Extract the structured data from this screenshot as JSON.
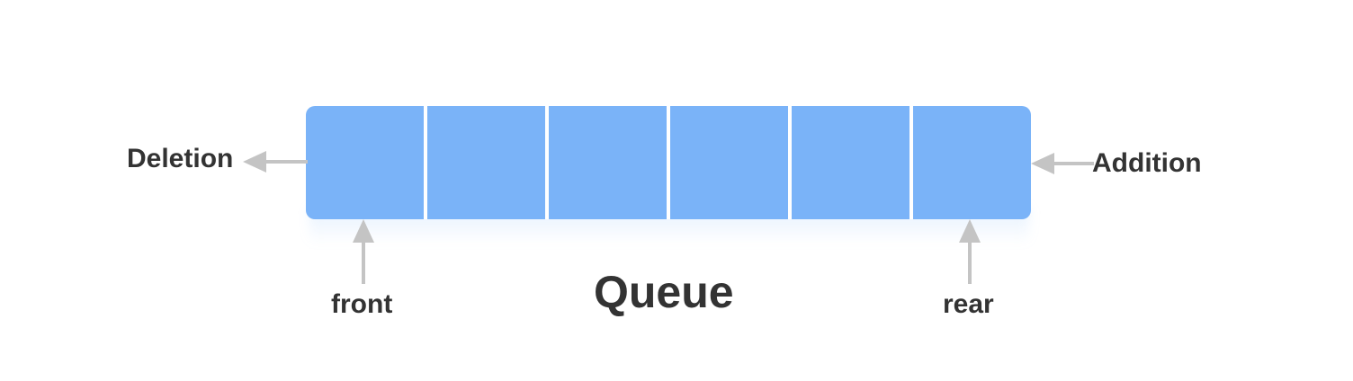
{
  "diagram": {
    "cell_count": 6,
    "labels": {
      "deletion": "Deletion",
      "addition": "Addition",
      "front": "front",
      "rear": "rear",
      "title": "Queue"
    },
    "colors": {
      "cell": "#7ab3f8",
      "arrow": "#c4c4c4",
      "text": "#333333"
    },
    "icons": {
      "deletion": "arrow-left-icon",
      "addition": "arrow-left-icon",
      "front": "arrow-up-icon",
      "rear": "arrow-up-icon"
    }
  }
}
